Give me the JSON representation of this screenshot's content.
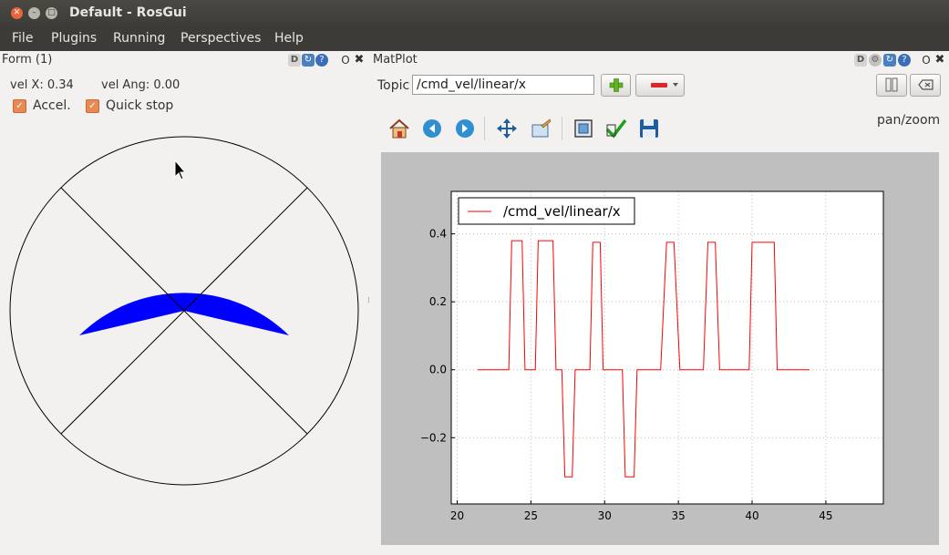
{
  "window": {
    "title": "Default - RosGui"
  },
  "menu": {
    "items": [
      "File",
      "Plugins",
      "Running",
      "Perspectives",
      "Help"
    ]
  },
  "form_dock": {
    "title": "Form (1)",
    "vel_x_label": "vel X: 0.34",
    "vel_ang_label": "vel Ang: 0.00",
    "accel_label": "Accel.",
    "accel_checked": true,
    "quick_stop_label": "Quick stop",
    "quick_stop_checked": true,
    "sector_color": "#0000ff"
  },
  "matplot_dock": {
    "title": "MatPlot",
    "topic_label": "Topic",
    "topic_value": "/cmd_vel/linear/x",
    "mode_text": "pan/zoom"
  },
  "chart_data": {
    "type": "line",
    "series": [
      {
        "name": "/cmd_vel/linear/x",
        "color": "#ff0000",
        "x": [
          21.4,
          23.5,
          23.7,
          24.4,
          24.6,
          25.3,
          25.5,
          26.5,
          26.7,
          27.1,
          27.3,
          27.8,
          28.0,
          29.0,
          29.2,
          29.7,
          29.9,
          31.2,
          31.4,
          32.0,
          32.2,
          33.8,
          34.2,
          34.7,
          35.1,
          36.7,
          37.0,
          37.5,
          37.8,
          39.8,
          40.0,
          41.5,
          41.7,
          43.9
        ],
        "y": [
          0.0,
          0.0,
          0.38,
          0.38,
          0.0,
          0.0,
          0.38,
          0.38,
          0.0,
          0.0,
          -0.315,
          -0.315,
          0.0,
          0.0,
          0.375,
          0.375,
          0.0,
          0.0,
          -0.315,
          -0.315,
          0.0,
          0.0,
          0.375,
          0.375,
          0.0,
          0.0,
          0.375,
          0.375,
          0.0,
          0.0,
          0.375,
          0.375,
          0.0,
          0.0
        ]
      }
    ],
    "xlim": [
      19.6,
      48.9
    ],
    "ylim": [
      -0.395,
      0.525
    ],
    "xticks": [
      20,
      25,
      30,
      35,
      40,
      45
    ],
    "yticks": [
      0.4,
      0.2,
      0.0,
      -0.2
    ],
    "xtick_labels": [
      "20",
      "25",
      "30",
      "35",
      "40",
      "45"
    ],
    "ytick_labels": [
      "0.4",
      "0.2",
      "0.0",
      "−0.2"
    ],
    "grid": true,
    "legend": "top-left"
  }
}
